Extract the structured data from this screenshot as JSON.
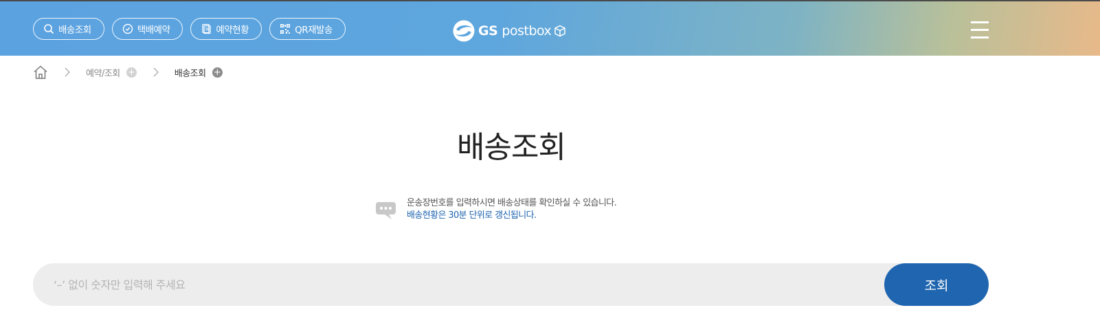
{
  "header": {
    "quick_nav": [
      {
        "label": "배송조회",
        "icon": "search-icon"
      },
      {
        "label": "택배예약",
        "icon": "clock-icon"
      },
      {
        "label": "예약현황",
        "icon": "document-icon"
      },
      {
        "label": "QR재발송",
        "icon": "qr-code-icon"
      }
    ],
    "logo_text_bold": "GS",
    "logo_text_rest": "postbox",
    "menu_icon": "hamburger-menu-icon"
  },
  "breadcrumb": {
    "home_icon": "home-icon",
    "items": [
      {
        "label": "예약/조회"
      },
      {
        "label": "배송조회"
      }
    ]
  },
  "main": {
    "title": "배송조회",
    "notice": {
      "icon": "speech-bubble-icon",
      "line1": "운송장번호를 입력하시면 배송상태를 확인하실 수 있습니다.",
      "line2": "배송현황은 30분 단위로 갱신됩니다."
    },
    "search": {
      "placeholder": "‘–’ 없이 숫자만 입력해 주세요",
      "value": "",
      "button_label": "조회"
    }
  },
  "colors": {
    "primary_blue": "#1f65af",
    "notice_blue": "#1f64b0",
    "header_gradient_start": "#5ba2e0",
    "header_gradient_end": "#e8b98a",
    "input_bg": "#ededed"
  }
}
